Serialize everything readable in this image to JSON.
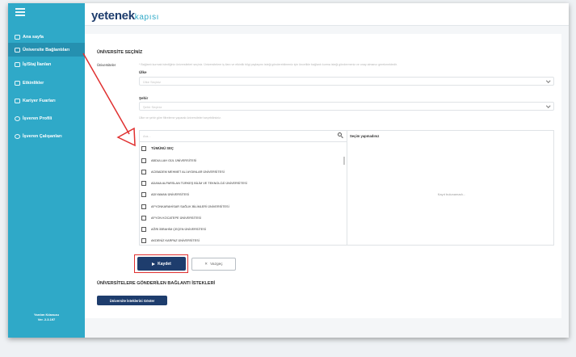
{
  "brand": {
    "logo_main": "yetenek",
    "logo_sub": "kapısı"
  },
  "sidebar": {
    "items": [
      {
        "label": "Ana sayfa",
        "active": false
      },
      {
        "label": "Üniversite Bağlantıları",
        "active": true
      },
      {
        "label": "İş/Staj İlanları",
        "active": false
      },
      {
        "label": "Etkinlikler",
        "active": false
      },
      {
        "label": "Kariyer Fuarları",
        "active": false
      },
      {
        "label": "İşveren Profili",
        "active": false
      },
      {
        "label": "İşveren Çalışanları",
        "active": false
      }
    ],
    "guide_label": "Yardım Kılavuzu",
    "version": "Ver. 2.3.197"
  },
  "form": {
    "section_title": "ÜNİVERSİTE SEÇİNİZ",
    "universities_label": "Üniversiteler",
    "universities_hint": "* Bağlantı kurmak istediğiniz üniversiteleri seçiniz. Üniversitelere iş ilanı ve etkinlik bilgi paylaşımı isteği gönderebilmeniz için öncelikle bağlantı kurma isteği göndermeniz ve onay almanız gerekmektedir.",
    "country_label": "Ülke",
    "country_placeholder": "Ülke Seçiniz",
    "city_label": "Şehir",
    "city_placeholder": "Şehir Seçiniz",
    "filter_hint": "Ülke ve şehir göre filtreleme yaparak üniversiteleri seçebilirsiniz.",
    "search_placeholder": "Ara...",
    "selection_header": "Seçim yapmadınız",
    "select_all": "TÜMÜNÜ SEÇ",
    "universities": [
      "ABDULLAH GÜL ÜNİVERSİTESİ",
      "ACIBADEM MEHMET ALİ AYDINLAR ÜNİVERSİTESİ",
      "ADANA ALPARSLAN TÜRKEŞ BİLİM VE TEKNOLOJİ ÜNİVERSİTESİ",
      "ADIYAMAN ÜNİVERSİTESİ",
      "AFYONKARAHİSAR SAĞLIK BİLİMLERİ ÜNİVERSİTESİ",
      "AFYON KOCATEPE ÜNİVERSİTESİ",
      "AĞRI İBRAHİM ÇEÇEN ÜNİVERSİTESİ",
      "AKDENİZ KARPAZ ÜNİVERSİTESİ"
    ],
    "empty_text": "Kayıt bulunamadı...",
    "save_label": "Kaydet",
    "cancel_label": "Vazgeç"
  },
  "requests": {
    "title": "ÜNİVERSİTELERE GÖNDERİLEN BAĞLANTI İSTEKLERİ",
    "show_button": "Üniversite İsteklerini Göster"
  },
  "colors": {
    "sidebar": "#2fa9c8",
    "sidebar_active": "#2590b0",
    "primary": "#1e3d6d",
    "annotation": "#e03030"
  }
}
